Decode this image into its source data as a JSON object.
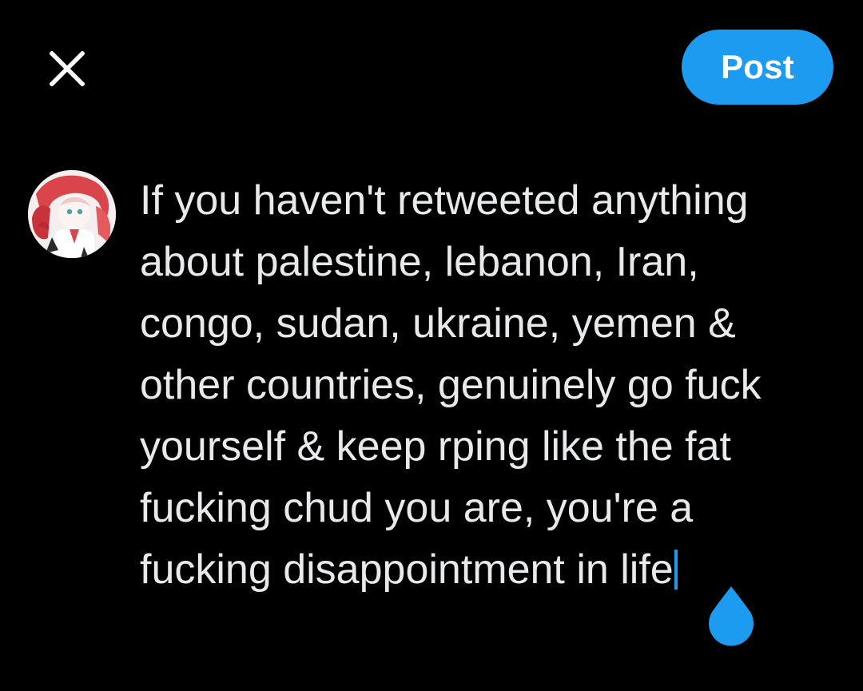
{
  "header": {
    "close_icon": "close-icon",
    "post_label": "Post"
  },
  "composer": {
    "avatar_icon": "user-avatar",
    "lines": [
      "If you haven't retweeted anything",
      "about palestine, lebanon, Iran,",
      "congo, sudan, ukraine, yemen &",
      "other countries, genuinely go fuck",
      "yourself & keep rping like the fat",
      "fucking chud you are, you're a",
      "fucking disappointment in life"
    ],
    "caret_handle_icon": "text-cursor-handle-icon"
  },
  "colors": {
    "background": "#000000",
    "text": "#e7e9ea",
    "accent": "#1d9bf0",
    "button_text": "#ffffff"
  }
}
